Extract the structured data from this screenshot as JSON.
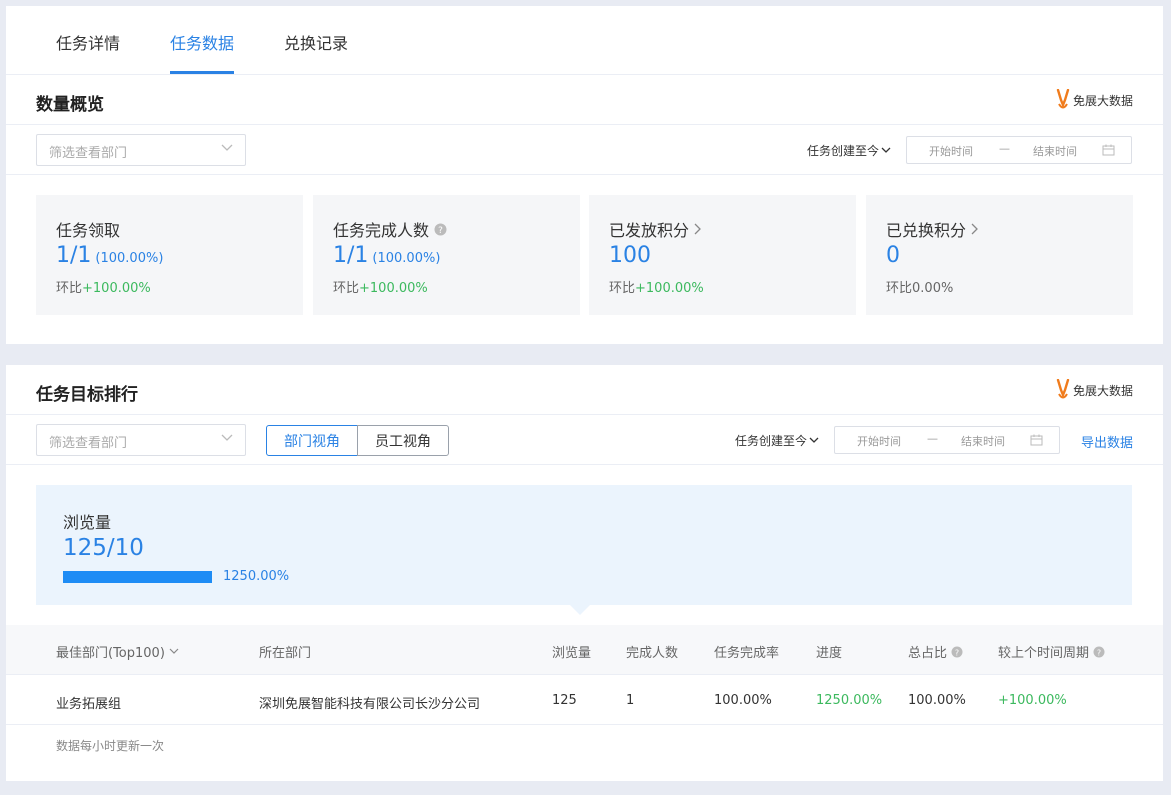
{
  "tabs": [
    {
      "label": "任务详情",
      "active": false
    },
    {
      "label": "任务数据",
      "active": true
    },
    {
      "label": "兑换记录",
      "active": false
    }
  ],
  "brand": {
    "name": "免展大数据",
    "color": "#f07c1d"
  },
  "colors": {
    "accent": "#2a82e4",
    "positive": "#3cb95e"
  },
  "overview": {
    "title": "数量概览",
    "filter_placeholder": "筛选查看部门",
    "range_label": "任务创建至今",
    "start_placeholder": "开始时间",
    "separator": "—",
    "end_placeholder": "结束时间",
    "cards": [
      {
        "label": "任务领取",
        "value": "1/1",
        "pct": "(100.00%)",
        "compare_prefix": "环比",
        "compare_value": "+100.00%",
        "icon": ""
      },
      {
        "label": "任务完成人数",
        "value": "1/1",
        "pct": "(100.00%)",
        "compare_prefix": "环比",
        "compare_value": "+100.00%",
        "icon": "help-icon"
      },
      {
        "label": "已发放积分",
        "value": "100",
        "pct": "",
        "compare_prefix": "环比",
        "compare_value": "+100.00%",
        "icon": "chevron-right-icon"
      },
      {
        "label": "已兑换积分",
        "value": "0",
        "pct": "",
        "compare_prefix": "环比",
        "compare_value": "0.00%",
        "icon": "chevron-right-icon"
      }
    ]
  },
  "ranking": {
    "title": "任务目标排行",
    "filter_placeholder": "筛选查看部门",
    "view_department": "部门视角",
    "view_employee": "员工视角",
    "range_label": "任务创建至今",
    "start_placeholder": "开始时间",
    "separator": "—",
    "end_placeholder": "结束时间",
    "export_label": "导出数据",
    "metric": {
      "label": "浏览量",
      "value": "125/10",
      "pct": "1250.00%",
      "fraction": 1.0
    },
    "columns": [
      "最佳部门(Top100)",
      "所在部门",
      "浏览量",
      "完成人数",
      "任务完成率",
      "进度",
      "总占比",
      "较上个时间周期"
    ],
    "rows": [
      {
        "best_dept": "业务拓展组",
        "dept": "深圳免展智能科技有限公司长沙分公司",
        "views": "125",
        "completed": "1",
        "rate": "100.00%",
        "progress": "1250.00%",
        "share": "100.00%",
        "change": "+100.00%"
      }
    ],
    "footnote": "数据每小时更新一次"
  }
}
